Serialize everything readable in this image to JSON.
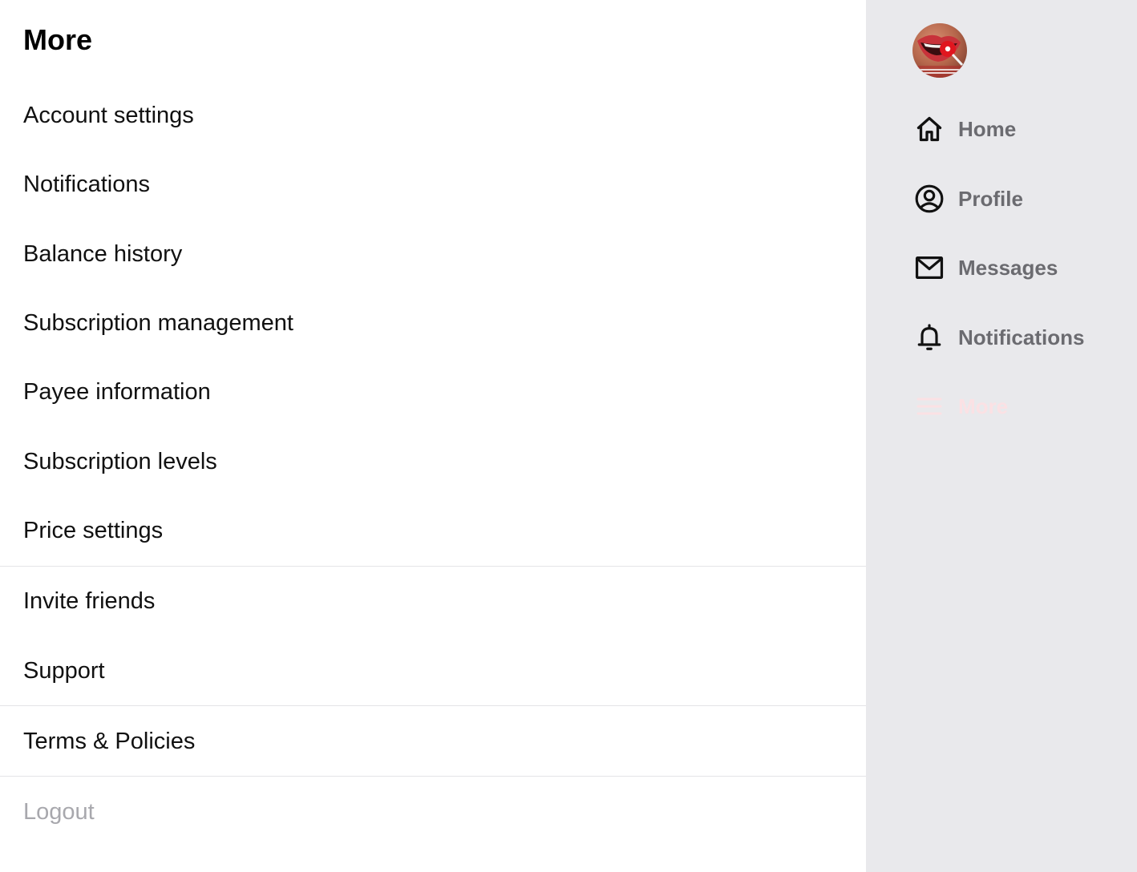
{
  "main": {
    "title": "More",
    "menu": [
      {
        "label": "Account settings"
      },
      {
        "label": "Notifications"
      },
      {
        "label": "Balance history"
      },
      {
        "label": "Subscription management"
      },
      {
        "label": "Payee information"
      },
      {
        "label": "Subscription levels"
      },
      {
        "label": "Price settings"
      },
      {
        "label": "Invite friends"
      },
      {
        "label": "Support"
      },
      {
        "label": "Terms & Policies"
      },
      {
        "label": "Logout"
      }
    ]
  },
  "sidebar": {
    "avatar_icon": "user-avatar",
    "nav": [
      {
        "label": "Home",
        "icon": "home-icon"
      },
      {
        "label": "Profile",
        "icon": "user-circle-icon"
      },
      {
        "label": "Messages",
        "icon": "envelope-icon"
      },
      {
        "label": "Notifications",
        "icon": "bell-icon"
      },
      {
        "label": "More",
        "icon": "menu-icon",
        "active": true
      }
    ]
  },
  "colors": {
    "sidebar_bg": "#e9e9ec",
    "nav_text": "#6b6b70",
    "active_accent": "#fbe1e4",
    "muted_text": "#a8a8ad",
    "divider": "#e4e4e7"
  }
}
